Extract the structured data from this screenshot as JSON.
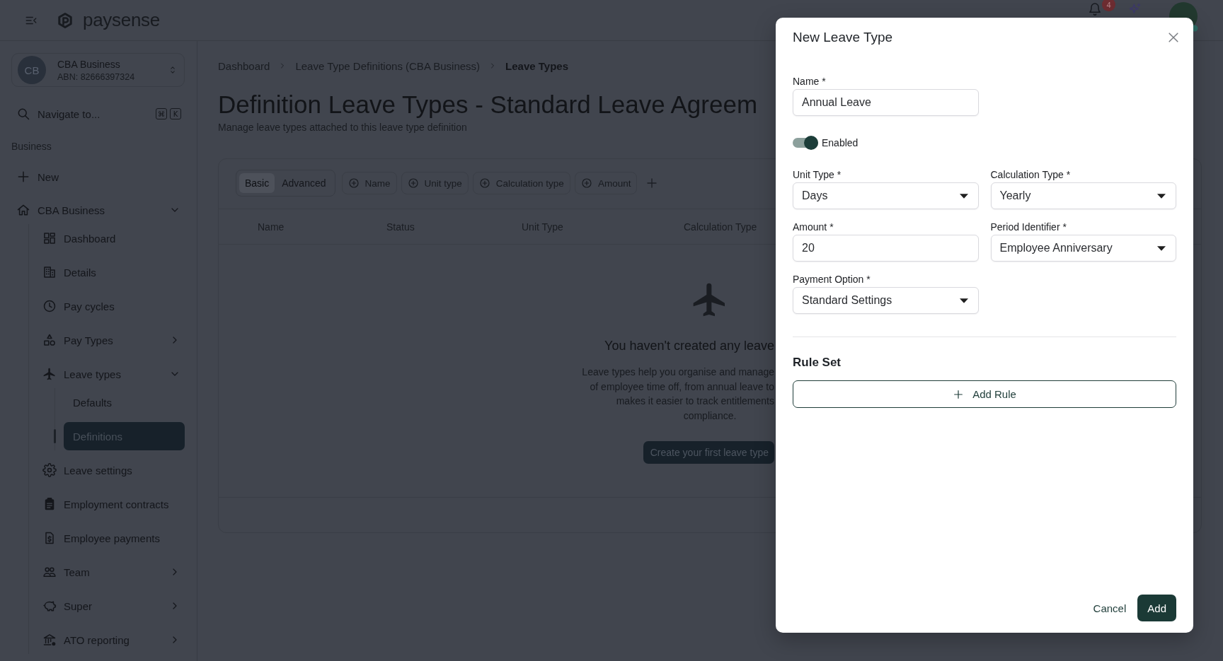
{
  "top_bar": {
    "brand": "paysense",
    "notification_count": "4"
  },
  "sidebar": {
    "business": {
      "initials": "CB",
      "name": "CBA Business",
      "abn": "ABN: 82666397324"
    },
    "navigate": {
      "label": "Navigate to...",
      "keys": [
        "⌘",
        "K"
      ]
    },
    "section_label": "Business",
    "new_item": {
      "label": "New"
    },
    "items": [
      {
        "label": "CBA Business",
        "selected": false,
        "expanded": true,
        "children": [
          {
            "label": "Dashboard",
            "selected": false
          },
          {
            "label": "Details",
            "selected": false
          },
          {
            "label": "Pay cycles",
            "selected": false
          },
          {
            "label": "Pay Types",
            "selected": false,
            "expanded": false
          },
          {
            "label": "Leave types",
            "selected": false,
            "expanded": true,
            "children": [
              {
                "label": "Defaults",
                "selected": false
              },
              {
                "label": "Definitions",
                "selected": true
              }
            ]
          },
          {
            "label": "Leave settings",
            "selected": false
          },
          {
            "label": "Employment contracts",
            "selected": false
          },
          {
            "label": "Employee payments",
            "selected": false
          },
          {
            "label": "Team",
            "selected": false,
            "expanded": false
          },
          {
            "label": "Super",
            "selected": false,
            "expanded": false
          },
          {
            "label": "ATO reporting",
            "selected": false,
            "expanded": false
          }
        ]
      }
    ]
  },
  "breadcrumbs": [
    {
      "label": "Dashboard",
      "current": false
    },
    {
      "label": "Leave Type Definitions (CBA Business)",
      "current": false
    },
    {
      "label": "Leave Types",
      "current": true
    }
  ],
  "page": {
    "title": "Definition Leave Types - Standard Leave Agreem",
    "subtitle": "Manage leave types attached to this leave type definition"
  },
  "table": {
    "modes": [
      {
        "label": "Basic",
        "selected": true
      },
      {
        "label": "Advanced",
        "selected": false
      }
    ],
    "filters": [
      "Name",
      "Unit type",
      "Calculation type",
      "Amount"
    ],
    "columns": [
      "Name",
      "Status",
      "Unit Type",
      "Calculation Type"
    ],
    "empty_state": {
      "title": "You haven't created any leave",
      "description_lines": [
        "Leave types help you organise and manage",
        "of employee time off, from annual leave to",
        "makes it easier to track entitlements",
        "compliance."
      ],
      "button": "Create your first leave type"
    }
  },
  "dialog": {
    "title": "New Leave Type",
    "rows": [
      [
        {
          "kind": "text",
          "label": "Name *",
          "value": "Annual Leave"
        }
      ],
      [
        {
          "kind": "toggle",
          "label": "Enabled",
          "on": true
        }
      ],
      [
        {
          "kind": "select",
          "label": "Unit Type *",
          "value": "Days"
        },
        {
          "kind": "select",
          "label": "Calculation Type *",
          "value": "Yearly"
        }
      ],
      [
        {
          "kind": "text",
          "label": "Amount *",
          "value": "20"
        },
        {
          "kind": "select",
          "label": "Period Identifier *",
          "value": "Employee Anniversary"
        }
      ],
      [
        {
          "kind": "select",
          "label": "Payment Option *",
          "value": "Standard Settings"
        }
      ]
    ],
    "section_title": "Rule Set",
    "add_rule": "Add Rule",
    "actions": [
      {
        "kind": "text",
        "label": "Cancel"
      },
      {
        "kind": "primary",
        "label": "Add"
      }
    ]
  }
}
